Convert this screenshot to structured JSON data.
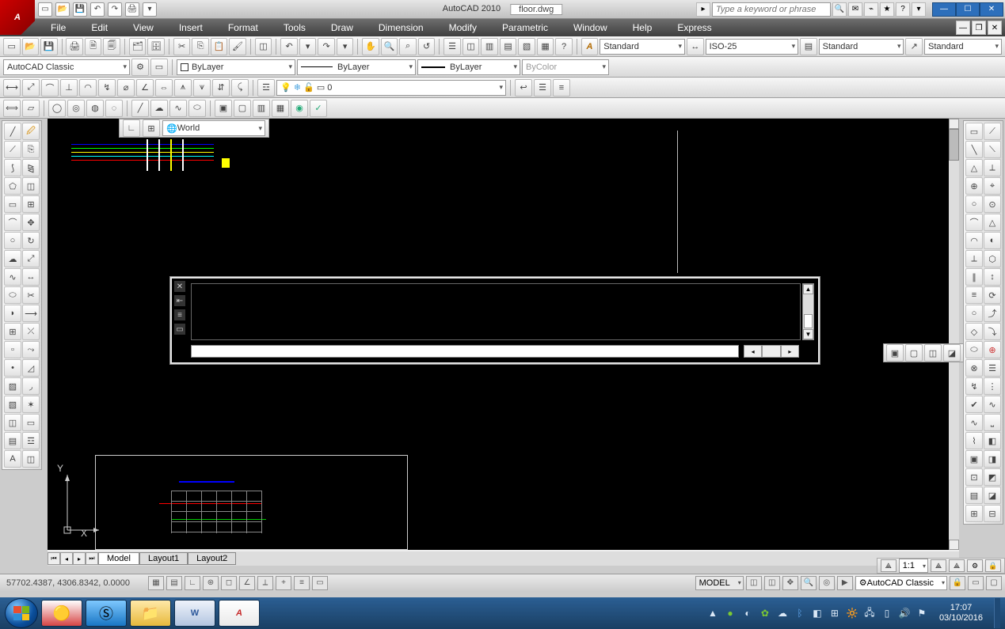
{
  "title": {
    "app": "AutoCAD 2010",
    "doc": "floor.dwg"
  },
  "search": {
    "placeholder": "Type a keyword or phrase"
  },
  "menu": [
    "File",
    "Edit",
    "View",
    "Insert",
    "Format",
    "Tools",
    "Draw",
    "Dimension",
    "Modify",
    "Parametric",
    "Window",
    "Help",
    "Express"
  ],
  "styleToolbars": {
    "textStyle": "Standard",
    "dimStyle": "ISO-25",
    "tableStyle": "Standard",
    "mleaderStyle": "Standard"
  },
  "workspace": "AutoCAD Classic",
  "layerCombo": "ByLayer",
  "colorCombo": "ByLayer",
  "linetypeCombo": "ByLayer",
  "lineweightCombo": "ByColor",
  "layerFilterValue": "0",
  "ucsCombo": "World",
  "tabs": {
    "model": "Model",
    "l1": "Layout1",
    "l2": "Layout2"
  },
  "coords": "57702.4387, 4306.8342, 0.0000",
  "statusRight": {
    "space": "MODEL",
    "workspace": "AutoCAD Classic",
    "annoscale": "1:1"
  },
  "axes": {
    "x": "X",
    "y": "Y"
  },
  "taskbar": {
    "time": "17:07",
    "date": "03/10/2016"
  },
  "appLogo": "A"
}
